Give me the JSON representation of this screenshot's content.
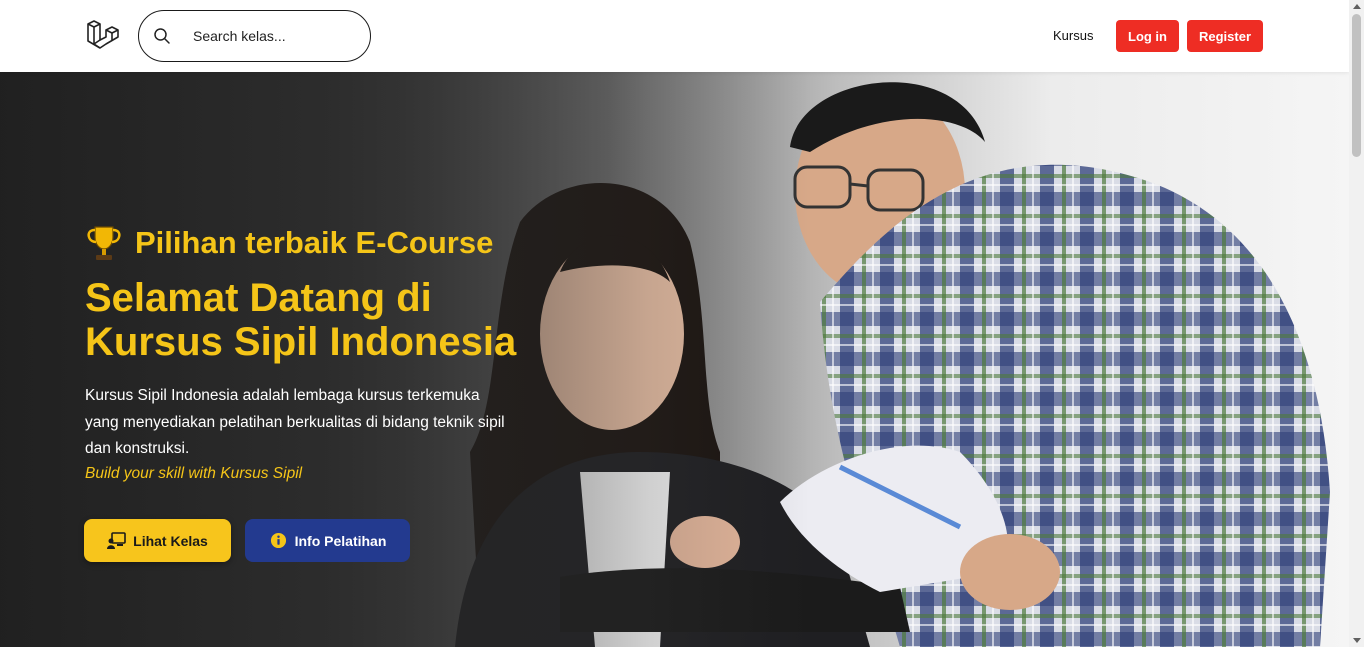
{
  "navbar": {
    "logo_icon": "laravel-logo-icon",
    "search": {
      "icon": "search-icon",
      "placeholder": "Search kelas..."
    },
    "link_kursus": "Kursus",
    "login_label": "Log in",
    "register_label": "Register"
  },
  "hero": {
    "tagline_icon": "trophy-icon",
    "tagline": "Pilihan terbaik E-Course",
    "title_line1": "Selamat Datang di",
    "title_line2": "Kursus Sipil Indonesia",
    "description": "Kursus Sipil Indonesia adalah lembaga kursus terkemuka yang menyediakan pelatihan berkualitas di bidang teknik sipil dan konstruksi.",
    "slogan": "Build your skill with Kursus Sipil",
    "cta_primary": {
      "icon": "chalkboard-teacher-icon",
      "label": "Lihat Kelas"
    },
    "cta_secondary": {
      "icon": "info-circle-icon",
      "label": "Info Pelatihan"
    }
  },
  "colors": {
    "accent_yellow": "#f5c518",
    "button_red": "#ee2d24",
    "button_blue": "#233a8f"
  }
}
